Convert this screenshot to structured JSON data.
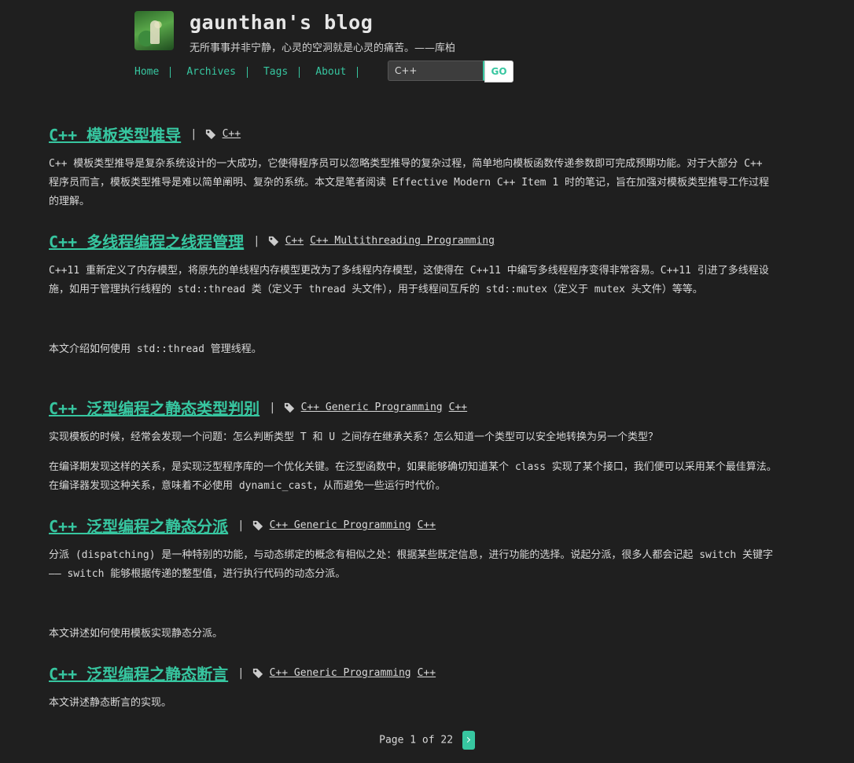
{
  "header": {
    "title": "gaunthan's blog",
    "subtitle": "无所事事并非宁静，心灵的空洞就是心灵的痛苦。——库柏"
  },
  "nav": {
    "items": [
      "Home",
      "Archives",
      "Tags",
      "About"
    ]
  },
  "search": {
    "value": "C++",
    "button": "GO"
  },
  "posts": [
    {
      "title": "C++ 模板类型推导",
      "tags": [
        "C++"
      ],
      "paragraphs": [
        "C++ 模板类型推导是复杂系统设计的一大成功，它使得程序员可以忽略类型推导的复杂过程，简单地向模板函数传递参数即可完成预期功能。对于大部分 C++ 程序员而言，模板类型推导是难以简单阐明、复杂的系统。本文是笔者阅读 Effective Modern C++ Item 1 时的笔记，旨在加强对模板类型推导工作过程的理解。"
      ]
    },
    {
      "title": "C++ 多线程编程之线程管理",
      "tags": [
        "C++",
        "C++ Multithreading Programming"
      ],
      "paragraphs": [
        "C++11 重新定义了内存模型，将原先的单线程内存模型更改为了多线程内存模型，这使得在 C++11 中编写多线程程序变得非常容易。C++11 引进了多线程设施，如用于管理执行线程的 std::thread 类（定义于 thread 头文件），用于线程间互斥的 std::mutex（定义于 mutex 头文件）等等。",
        "本文介绍如何使用 std::thread 管理线程。"
      ]
    },
    {
      "title": "C++ 泛型编程之静态类型判别",
      "tags": [
        "C++ Generic Programming",
        "C++"
      ],
      "paragraphs": [
        "实现模板的时候，经常会发现一个问题：怎么判断类型 T 和 U 之间存在继承关系？怎么知道一个类型可以安全地转换为另一个类型？",
        "在编译期发现这样的关系，是实现泛型程序库的一个优化关键。在泛型函数中，如果能够确切知道某个 class 实现了某个接口，我们便可以采用某个最佳算法。在编译器发现这种关系，意味着不必使用 dynamic_cast，从而避免一些运行时代价。"
      ]
    },
    {
      "title": "C++ 泛型编程之静态分派",
      "tags": [
        "C++ Generic Programming",
        "C++"
      ],
      "paragraphs": [
        "分派 (dispatching) 是一种特别的功能，与动态绑定的概念有相似之处：根据某些既定信息，进行功能的选择。说起分派，很多人都会记起 switch 关键字 —— switch 能够根据传递的整型值，进行执行代码的动态分派。",
        "本文讲述如何使用模板实现静态分派。"
      ]
    },
    {
      "title": "C++ 泛型编程之静态断言",
      "tags": [
        "C++ Generic Programming",
        "C++"
      ],
      "paragraphs": [
        "本文讲述静态断言的实现。"
      ]
    }
  ],
  "pager": {
    "text": "Page 1 of 22"
  }
}
